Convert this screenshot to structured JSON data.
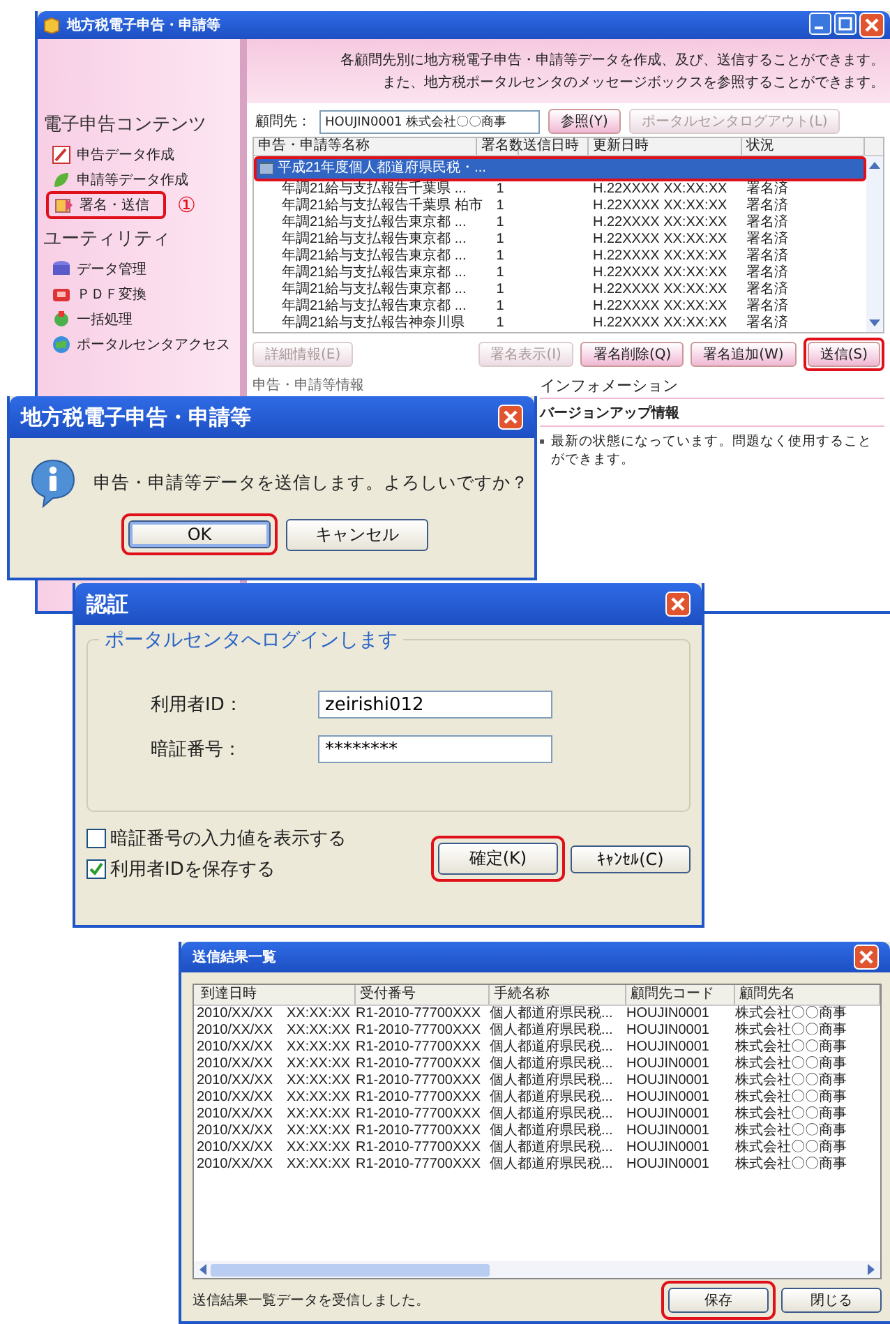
{
  "main_window": {
    "title": "地方税電子申告・申請等",
    "banner": [
      "各顧問先別に地方税電子申告・申請等データを作成、及び、送信することができます。",
      "また、地方税ポータルセンタのメッセージボックスを参照することができます。"
    ],
    "sidebar": {
      "sections": [
        {
          "heading": "電子申告コンテンツ",
          "items": [
            {
              "label": "申告データ作成",
              "highlighted": false
            },
            {
              "label": "申請等データ作成",
              "highlighted": false
            },
            {
              "label": "署名・送信",
              "highlighted": true
            }
          ]
        },
        {
          "heading": "ユーティリティ",
          "items": [
            {
              "label": "データ管理",
              "highlighted": false
            },
            {
              "label": "ＰＤＦ変換",
              "highlighted": false
            },
            {
              "label": "一括処理",
              "highlighted": false
            },
            {
              "label": "ポータルセンタアクセス",
              "highlighted": false
            }
          ]
        }
      ],
      "step_marker": "①"
    },
    "client": {
      "label": "顧問先：",
      "value": "HOUJIN0001 株式会社〇〇商事",
      "buttons": [
        {
          "label": "参照(Y)",
          "disabled": false
        },
        {
          "label": "ポータルセンタログアウト(L)",
          "disabled": true
        }
      ]
    },
    "table": {
      "columns": [
        "申告・申請等名称",
        "署名数",
        "送信日時",
        "更新日時",
        "状況"
      ],
      "rows": [
        {
          "kind": "group",
          "name": "平成21年度個人都道府県民税・...",
          "selected": true,
          "highlighted": true
        },
        {
          "kind": "item",
          "name": "年調21給与支払報告千葉県 ...",
          "signatures": "1",
          "updated": "H.22XXXX XX:XX:XX",
          "status": "署名済",
          "selected": false,
          "highlighted": false
        },
        {
          "kind": "item",
          "name": "年調21給与支払報告千葉県 柏市",
          "signatures": "1",
          "updated": "H.22XXXX XX:XX:XX",
          "status": "署名済",
          "selected": false,
          "highlighted": false
        },
        {
          "kind": "item",
          "name": "年調21給与支払報告東京都 ...",
          "signatures": "1",
          "updated": "H.22XXXX XX:XX:XX",
          "status": "署名済",
          "selected": false,
          "highlighted": false
        },
        {
          "kind": "item",
          "name": "年調21給与支払報告東京都 ...",
          "signatures": "1",
          "updated": "H.22XXXX XX:XX:XX",
          "status": "署名済",
          "selected": false,
          "highlighted": false
        },
        {
          "kind": "item",
          "name": "年調21給与支払報告東京都 ...",
          "signatures": "1",
          "updated": "H.22XXXX XX:XX:XX",
          "status": "署名済",
          "selected": false,
          "highlighted": false
        },
        {
          "kind": "item",
          "name": "年調21給与支払報告東京都 ...",
          "signatures": "1",
          "updated": "H.22XXXX XX:XX:XX",
          "status": "署名済",
          "selected": false,
          "highlighted": false
        },
        {
          "kind": "item",
          "name": "年調21給与支払報告東京都 ...",
          "signatures": "1",
          "updated": "H.22XXXX XX:XX:XX",
          "status": "署名済",
          "selected": false,
          "highlighted": false
        },
        {
          "kind": "item",
          "name": "年調21給与支払報告東京都 ...",
          "signatures": "1",
          "updated": "H.22XXXX XX:XX:XX",
          "status": "署名済",
          "selected": false,
          "highlighted": false
        },
        {
          "kind": "item",
          "name": "年調21給与支払報告神奈川県",
          "signatures": "1",
          "updated": "H.22XXXX XX:XX:XX",
          "status": "署名済",
          "selected": false,
          "highlighted": false
        }
      ]
    },
    "buttons": [
      {
        "label": "詳細情報(E)",
        "disabled": true,
        "highlighted": false
      },
      {
        "label": "署名表示(I)",
        "disabled": true,
        "highlighted": false
      },
      {
        "label": "署名削除(Q)",
        "disabled": false,
        "highlighted": false
      },
      {
        "label": "署名追加(W)",
        "disabled": false,
        "highlighted": false
      },
      {
        "label": "送信(S)",
        "disabled": false,
        "highlighted": true
      }
    ],
    "detail_heading": "申告・申請等情報",
    "info": {
      "heading": "インフォメーション",
      "title": "バージョンアップ情報",
      "items": [
        "最新の状態になっています。問題なく使用することができます。"
      ]
    }
  },
  "confirm_dialog": {
    "title": "地方税電子申告・申請等",
    "message": "申告・申請等データを送信します。よろしいですか？",
    "buttons": [
      {
        "label": "OK",
        "default": true,
        "highlighted": true
      },
      {
        "label": "キャンセル",
        "default": false,
        "highlighted": false
      }
    ]
  },
  "auth_dialog": {
    "title": "認証",
    "group_title": "ポータルセンタへログインします",
    "fields": [
      {
        "label": "利用者ID：",
        "value": "zeirishi012"
      },
      {
        "label": "暗証番号：",
        "value": "********"
      }
    ],
    "checkboxes": [
      {
        "label": "暗証番号の入力値を表示する",
        "checked": false
      },
      {
        "label": "利用者IDを保存する",
        "checked": true
      }
    ],
    "buttons": [
      {
        "label": "確定(K)",
        "highlighted": true
      },
      {
        "label": "ｷｬﾝｾﾙ(C)",
        "highlighted": false
      }
    ]
  },
  "results_window": {
    "title": "送信結果一覧",
    "columns": [
      "到達日時",
      "受付番号",
      "手続名称",
      "顧問先コード",
      "顧問先名"
    ],
    "rows": [
      [
        "2010/XX/XX　XX:XX:XX",
        "R1-2010-77700XXX",
        "個人都道府県民税...",
        "HOUJIN0001",
        "株式会社〇〇商事"
      ],
      [
        "2010/XX/XX　XX:XX:XX",
        "R1-2010-77700XXX",
        "個人都道府県民税...",
        "HOUJIN0001",
        "株式会社〇〇商事"
      ],
      [
        "2010/XX/XX　XX:XX:XX",
        "R1-2010-77700XXX",
        "個人都道府県民税...",
        "HOUJIN0001",
        "株式会社〇〇商事"
      ],
      [
        "2010/XX/XX　XX:XX:XX",
        "R1-2010-77700XXX",
        "個人都道府県民税...",
        "HOUJIN0001",
        "株式会社〇〇商事"
      ],
      [
        "2010/XX/XX　XX:XX:XX",
        "R1-2010-77700XXX",
        "個人都道府県民税...",
        "HOUJIN0001",
        "株式会社〇〇商事"
      ],
      [
        "2010/XX/XX　XX:XX:XX",
        "R1-2010-77700XXX",
        "個人都道府県民税...",
        "HOUJIN0001",
        "株式会社〇〇商事"
      ],
      [
        "2010/XX/XX　XX:XX:XX",
        "R1-2010-77700XXX",
        "個人都道府県民税...",
        "HOUJIN0001",
        "株式会社〇〇商事"
      ],
      [
        "2010/XX/XX　XX:XX:XX",
        "R1-2010-77700XXX",
        "個人都道府県民税...",
        "HOUJIN0001",
        "株式会社〇〇商事"
      ],
      [
        "2010/XX/XX　XX:XX:XX",
        "R1-2010-77700XXX",
        "個人都道府県民税...",
        "HOUJIN0001",
        "株式会社〇〇商事"
      ],
      [
        "2010/XX/XX　XX:XX:XX",
        "R1-2010-77700XXX",
        "個人都道府県民税...",
        "HOUJIN0001",
        "株式会社〇〇商事"
      ]
    ],
    "status": "送信結果一覧データを受信しました。",
    "buttons": [
      {
        "label": "保存",
        "highlighted": true
      },
      {
        "label": "閉じる",
        "highlighted": false
      }
    ]
  }
}
